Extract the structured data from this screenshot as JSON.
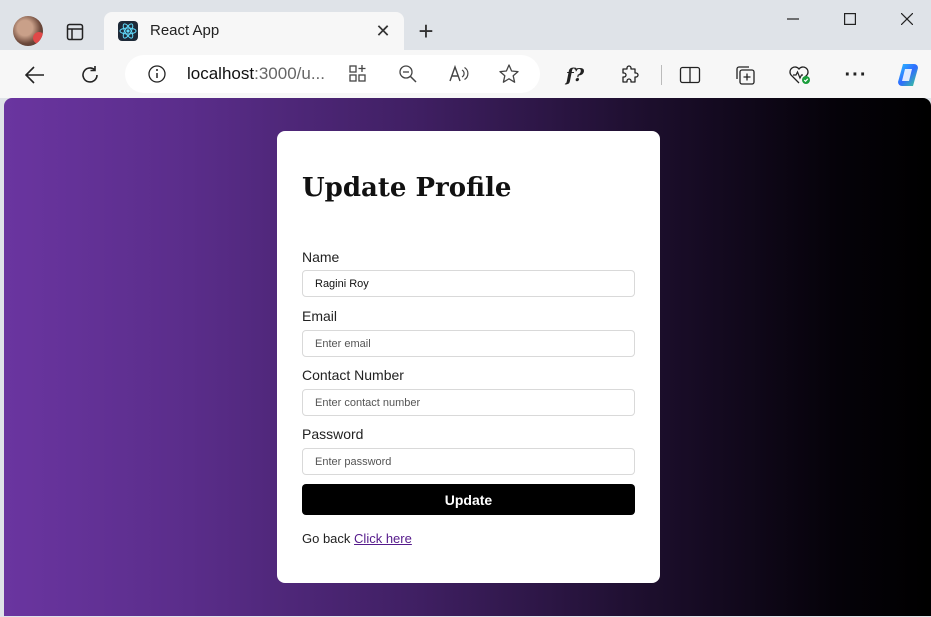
{
  "browser": {
    "tab_title": "React App",
    "url_host": "localhost",
    "url_rest": ":3000/u...",
    "tab_close_glyph": "✕",
    "new_tab_glyph": "+",
    "window_minimize": "—",
    "window_maximize": "☐",
    "window_close": "✕"
  },
  "form": {
    "title": "Update Profile",
    "fields": [
      {
        "label": "Name",
        "value": "Ragini Roy",
        "placeholder": ""
      },
      {
        "label": "Email",
        "value": "",
        "placeholder": "Enter email"
      },
      {
        "label": "Contact Number",
        "value": "",
        "placeholder": "Enter contact number"
      },
      {
        "label": "Password",
        "value": "",
        "placeholder": "Enter password"
      }
    ],
    "submit_label": "Update",
    "goback_text": "Go back",
    "goback_link": "Click here"
  },
  "colors": {
    "accent": "#000000",
    "gradient_start": "#6a35a0",
    "gradient_end": "#000000",
    "link": "#551a8b"
  }
}
